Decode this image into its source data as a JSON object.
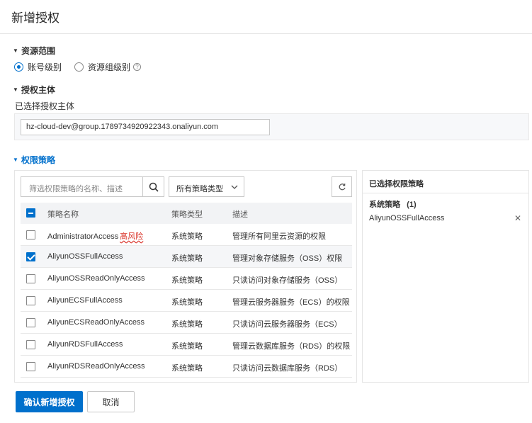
{
  "header": {
    "title": "新增授权"
  },
  "sections": {
    "scope": {
      "title": "资源范围"
    },
    "principal": {
      "title": "授权主体"
    },
    "policies": {
      "title": "权限策略"
    }
  },
  "scope": {
    "options": [
      {
        "label": "账号级别",
        "checked": true
      },
      {
        "label": "资源组级别",
        "checked": false
      }
    ]
  },
  "principal": {
    "label": "已选择授权主体",
    "value": "hz-cloud-dev@group.1789734920922343.onaliyun.com"
  },
  "policy_list": {
    "search_placeholder": "筛选权限策略的名称、描述",
    "type_filter": "所有策略类型",
    "columns": [
      "策略名称",
      "策略类型",
      "描述"
    ],
    "rows": [
      {
        "name": "AdministratorAccess",
        "risk": "高风险",
        "type": "系统策略",
        "desc": "管理所有阿里云资源的权限",
        "checked": false
      },
      {
        "name": "AliyunOSSFullAccess",
        "risk": "",
        "type": "系统策略",
        "desc": "管理对象存储服务（OSS）权限",
        "checked": true
      },
      {
        "name": "AliyunOSSReadOnlyAccess",
        "risk": "",
        "type": "系统策略",
        "desc": "只读访问对象存储服务（OSS）",
        "checked": false
      },
      {
        "name": "AliyunECSFullAccess",
        "risk": "",
        "type": "系统策略",
        "desc": "管理云服务器服务（ECS）的权限",
        "checked": false
      },
      {
        "name": "AliyunECSReadOnlyAccess",
        "risk": "",
        "type": "系统策略",
        "desc": "只读访问云服务器服务（ECS）",
        "checked": false
      },
      {
        "name": "AliyunRDSFullAccess",
        "risk": "",
        "type": "系统策略",
        "desc": "管理云数据库服务（RDS）的权限",
        "checked": false
      },
      {
        "name": "AliyunRDSReadOnlyAccess",
        "risk": "",
        "type": "系统策略",
        "desc": "只读访问云数据库服务（RDS）",
        "checked": false
      }
    ]
  },
  "selected_panel": {
    "title": "已选择权限策略",
    "group_label": "系统策略",
    "group_count": "(1)",
    "items": [
      "AliyunOSSFullAccess"
    ]
  },
  "footer": {
    "confirm_label": "确认新增授权",
    "cancel_label": "取消"
  },
  "colors": {
    "accent": "#0070cc",
    "risk": "#d93026"
  },
  "icons": {
    "search": "search-icon",
    "refresh": "refresh-icon",
    "dropdown": "chevron-down-icon",
    "help": "help-icon",
    "close": "close-icon"
  }
}
